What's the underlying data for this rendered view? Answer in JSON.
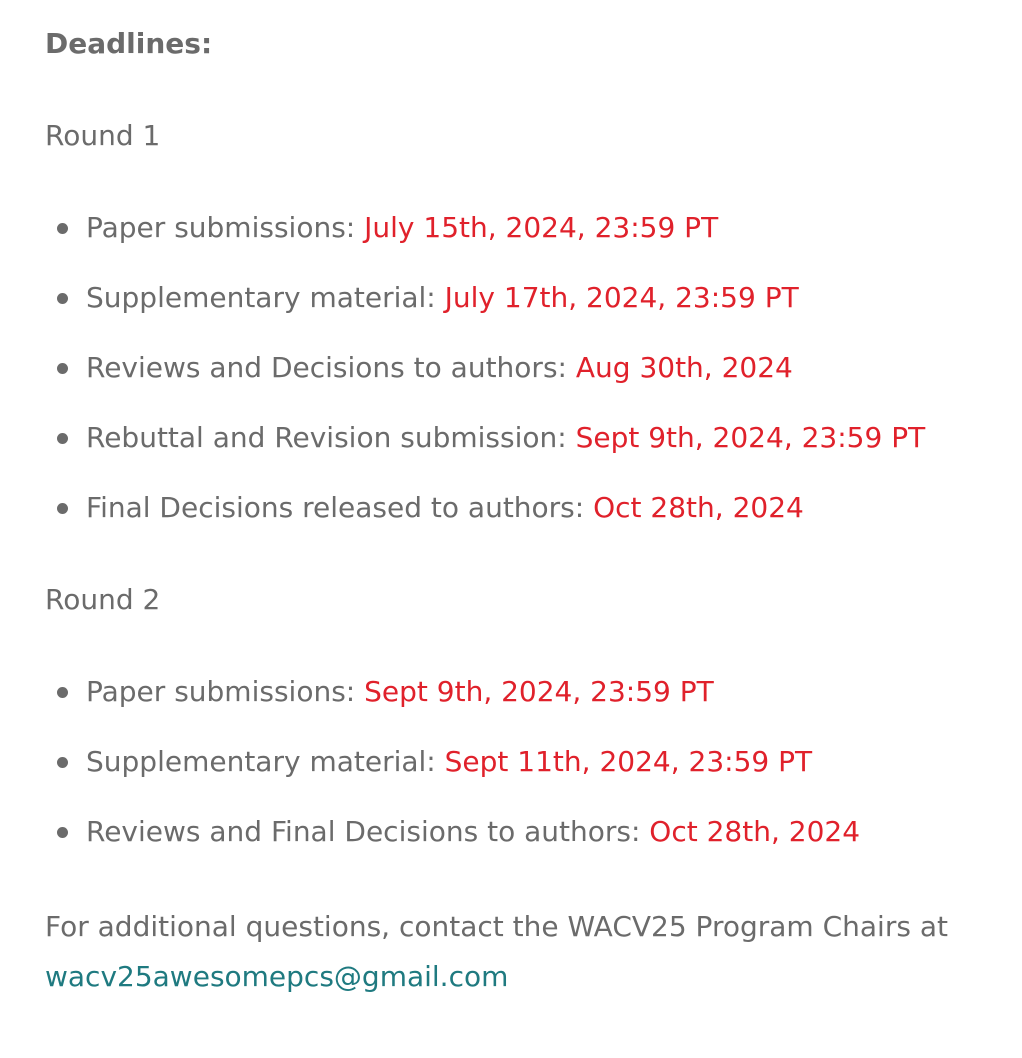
{
  "heading": "Deadlines:",
  "rounds": [
    {
      "title": "Round 1",
      "items": [
        {
          "label": "Paper submissions: ",
          "date": "July 15th, 2024, 23:59 PT"
        },
        {
          "label": "Supplementary material: ",
          "date": "July 17th, 2024, 23:59 PT"
        },
        {
          "label": "Reviews and Decisions to authors: ",
          "date": "Aug 30th, 2024"
        },
        {
          "label": "Rebuttal and Revision submission: ",
          "date": "Sept 9th, 2024, 23:59 PT"
        },
        {
          "label": "Final Decisions released to authors: ",
          "date": "Oct 28th, 2024"
        }
      ]
    },
    {
      "title": "Round 2",
      "items": [
        {
          "label": "Paper submissions: ",
          "date": "Sept 9th, 2024, 23:59 PT"
        },
        {
          "label": "Supplementary material: ",
          "date": "Sept 11th, 2024, 23:59 PT"
        },
        {
          "label": "Reviews and Final Decisions to authors: ",
          "date": "Oct 28th, 2024"
        }
      ]
    }
  ],
  "contact": {
    "text": "For additional questions, contact the WACV25 Program Chairs at",
    "email": "wacv25awesomepcs@gmail.com"
  },
  "colors": {
    "text": "#6b6b6b",
    "date": "#e0212b",
    "link": "#1f7a80"
  }
}
